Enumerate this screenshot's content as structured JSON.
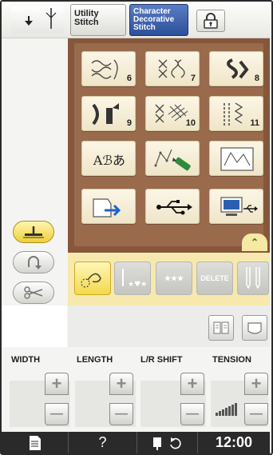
{
  "top_bar": {
    "utility_tab_line1": "Utility",
    "utility_tab_line2": "Stitch",
    "character_tab_line1": "Character",
    "character_tab_line2": "Decorative",
    "character_tab_line3": "Stitch",
    "needle_icon": "twin-needle-icon",
    "lock_icon": "lock-icon"
  },
  "pattern_grid": {
    "rows": [
      [
        {
          "icon": "floral-stitch-icon",
          "number": "6"
        },
        {
          "icon": "cross-stitch-icon",
          "number": "7"
        },
        {
          "icon": "satin-stitch-icon",
          "number": "8"
        }
      ],
      [
        {
          "icon": "satin-wave-icon",
          "number": "9"
        },
        {
          "icon": "cross-grid-icon",
          "number": "10"
        },
        {
          "icon": "zigzag-lines-icon",
          "number": "11"
        }
      ],
      [
        {
          "icon": "alphabet-text",
          "label": "Aℬあ"
        },
        {
          "icon": "custom-stitch-pen-icon"
        },
        {
          "icon": "custom-stitch-frame-icon"
        }
      ],
      [
        {
          "icon": "memory-pocket-icon"
        },
        {
          "icon": "usb-icon"
        },
        {
          "icon": "computer-usb-icon"
        }
      ]
    ]
  },
  "strip": {
    "delete_label": "DELETE",
    "stars_label": "★★★"
  },
  "settings": {
    "width_label": "WIDTH",
    "length_label": "LENGTH",
    "lr_shift_label": "L/R SHIFT",
    "tension_label": "TENSION",
    "plus": "+",
    "minus": "—"
  },
  "bottom_bar": {
    "help": "?",
    "time": "12:00"
  },
  "colors": {
    "panel_brown": "#86573a",
    "strip_yellow": "#f7e9ad",
    "tab_blue": "#2c4f9a",
    "active_yellow": "#f0cf38"
  }
}
